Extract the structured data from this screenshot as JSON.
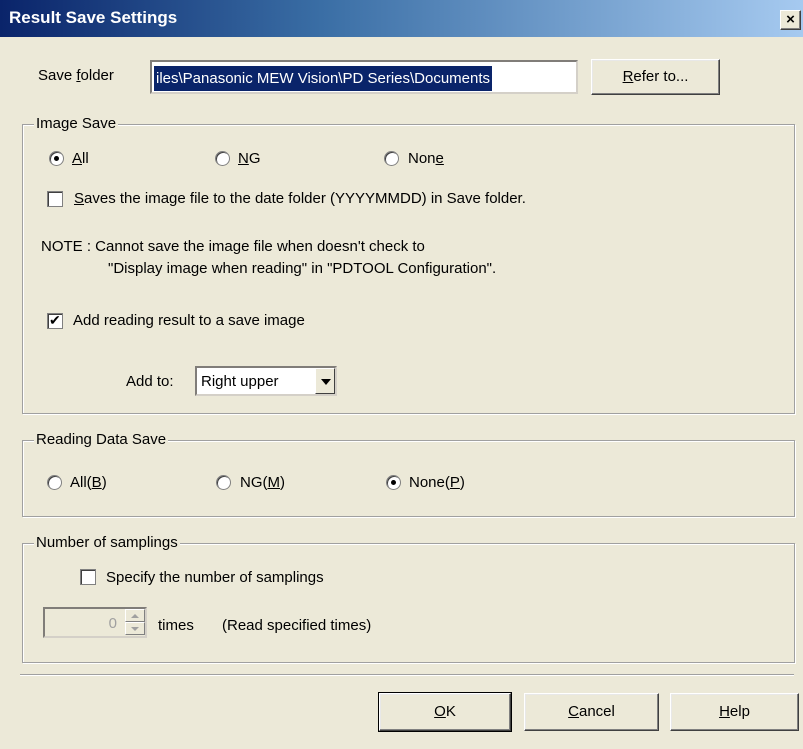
{
  "window": {
    "title": "Result Save Settings",
    "close_glyph": "×"
  },
  "save_folder": {
    "label_pre": "Save ",
    "label_accel": "f",
    "label_post": "older",
    "value": "iles\\Panasonic MEW Vision\\PD Series\\Documents",
    "refer_pre": "",
    "refer_accel": "R",
    "refer_post": "efer to..."
  },
  "image_save": {
    "group_label": "Image Save",
    "radios": [
      {
        "pre": "",
        "accel": "A",
        "post": "ll",
        "checked": true
      },
      {
        "pre": "",
        "accel": "N",
        "post": "G",
        "checked": false
      },
      {
        "pre": "Non",
        "accel": "e",
        "post": "",
        "checked": false
      }
    ],
    "date_folder": {
      "pre": "",
      "accel": "S",
      "post": "aves the image file to the date folder (YYYYMMDD) in Save folder.",
      "checked": false
    },
    "note_line1": "NOTE : Cannot save the image file when doesn't check to",
    "note_line2": "\"Display image when reading\" in \"PDTOOL Configuration\".",
    "add_result": {
      "label": "Add reading result to a save image",
      "checked": true
    },
    "add_to": {
      "label": "Add to:",
      "value": "Right upper"
    }
  },
  "reading_data_save": {
    "group_label": "Reading Data Save",
    "radios": [
      {
        "pre": "All(",
        "accel": "B",
        "post": ")",
        "checked": false
      },
      {
        "pre": "NG(",
        "accel": "M",
        "post": ")",
        "checked": false
      },
      {
        "pre": "None(",
        "accel": "P",
        "post": ")",
        "checked": true
      }
    ]
  },
  "samplings": {
    "group_label": "Number of samplings",
    "specify": {
      "label": "Specify the number of samplings",
      "checked": false
    },
    "count": "0",
    "times_label": "times",
    "hint": "(Read specified times)"
  },
  "buttons": {
    "ok": {
      "pre": "",
      "accel": "O",
      "post": "K"
    },
    "cancel": {
      "pre": "",
      "accel": "C",
      "post": "ancel"
    },
    "help": {
      "pre": "",
      "accel": "H",
      "post": "elp"
    }
  }
}
